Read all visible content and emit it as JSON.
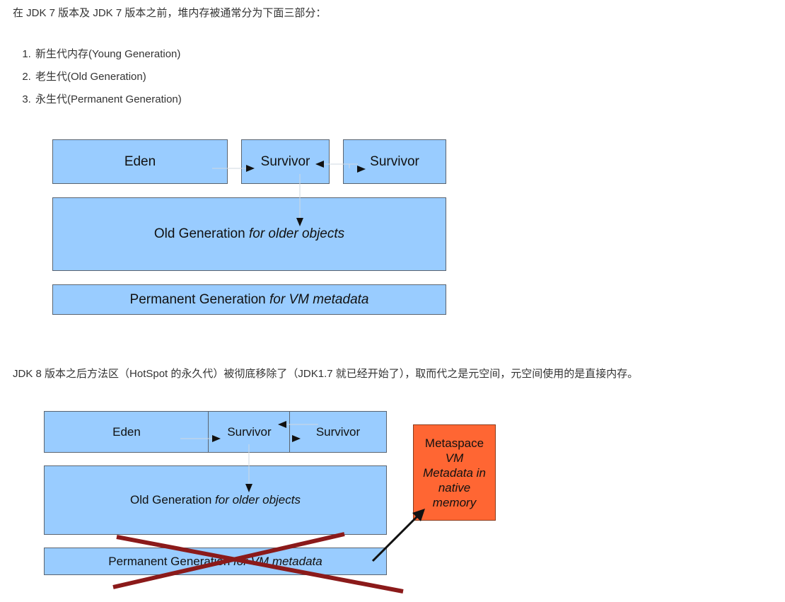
{
  "intro": "在 JDK 7 版本及 JDK 7 版本之前，堆内存被通常分为下面三部分：",
  "generations": [
    "新生代内存(Young Generation)",
    "老生代(Old Generation)",
    "永生代(Permanent Generation)"
  ],
  "diagram1": {
    "eden": "Eden",
    "survivor_a": "Survivor",
    "survivor_b": "Survivor",
    "old_gen": "Old Generation",
    "old_gen_note": "for older objects",
    "perm_gen": "Permanent Generation",
    "perm_gen_note": "for VM metadata"
  },
  "jdk8_text": "JDK 8 版本之后方法区（HotSpot 的永久代）被彻底移除了（JDK1.7 就已经开始了），取而代之是元空间，元空间使用的是直接内存。",
  "diagram2": {
    "eden": "Eden",
    "survivor_a": "Survivor",
    "survivor_b": "Survivor",
    "old_gen": "Old Generation",
    "old_gen_note": "for older objects",
    "perm_gen": "Permanent Generation",
    "perm_gen_note": "for VM metadata",
    "metaspace_title": "Metaspace",
    "metaspace_lines": [
      "VM",
      "Metadata in",
      "native",
      "memory"
    ]
  },
  "colors": {
    "box_fill": "#99ccff",
    "metaspace_fill": "#ff6633",
    "cross": "#8b1a1a"
  }
}
